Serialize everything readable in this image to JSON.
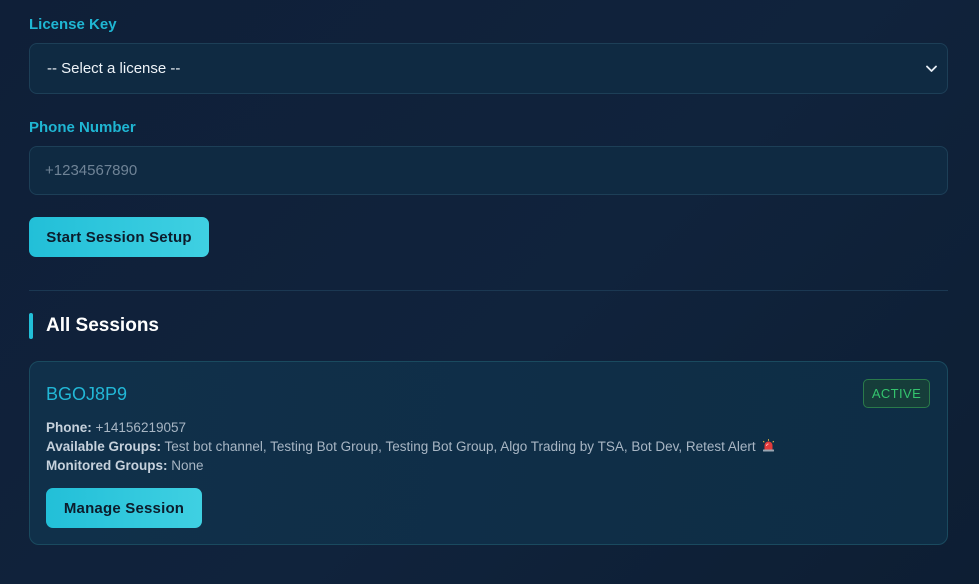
{
  "form": {
    "license_label": "License Key",
    "license_selected": "-- Select a license --",
    "phone_label": "Phone Number",
    "phone_placeholder": "+1234567890",
    "start_button": "Start Session Setup"
  },
  "sessions": {
    "title": "All Sessions",
    "items": [
      {
        "id": "BGOJ8P9",
        "status": "ACTIVE",
        "phone_label": "Phone:",
        "phone": "+14156219057",
        "available_label": "Available Groups:",
        "available": "Test bot channel, Testing Bot Group, Testing Bot Group, Algo Trading by TSA, Bot Dev, Retest Alert",
        "available_icon": "rotating-light-icon",
        "monitored_label": "Monitored Groups:",
        "monitored": "None",
        "manage_button": "Manage Session"
      }
    ]
  },
  "colors": {
    "accent": "#22bfd8",
    "background": "#0f1f38",
    "active_badge": "#34c46e"
  }
}
